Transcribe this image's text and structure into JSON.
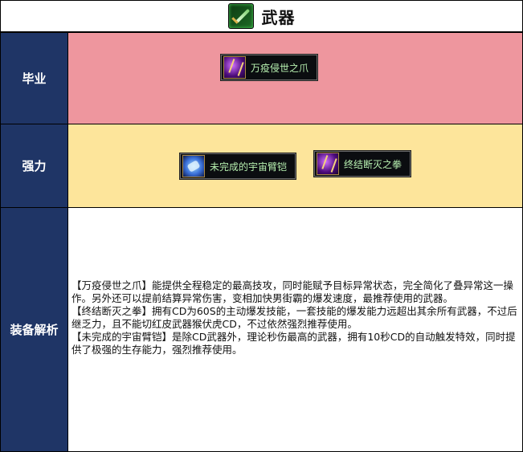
{
  "header": {
    "title": "武器",
    "icon": "sword-icon"
  },
  "rows": {
    "graduation": {
      "label": "毕业",
      "items": [
        {
          "name": "万疫侵世之爪",
          "icon": "claw-icon"
        }
      ]
    },
    "strong": {
      "label": "强力",
      "items": [
        {
          "name": "未完成的宇宙臂铠",
          "icon": "arm-guard-icon"
        },
        {
          "name": "终结断灭之拳",
          "icon": "fist-icon"
        }
      ]
    },
    "analysis": {
      "label": "装备解析",
      "paragraphs": [
        "【万疫侵世之爪】能提供全程稳定的最高技攻，同时能赋予目标异常状态，完全简化了叠异常这一操作。另外还可以提前结算异常伤害，变相加快男街霸的爆发速度，最推荐使用的武器。",
        "【终结断灭之拳】拥有CD为60S的主动爆发技能，一套技能的爆发能力远超出其余所有武器，不过后继乏力，且不能切红皮武器猴伏虎CD，不过依然强烈推荐使用。",
        "【未完成的宇宙臂铠】是除CD武器外，理论秒伤最高的武器，拥有10秒CD的自动触发特效，同时提供了极强的生存能力，强烈推荐使用。"
      ]
    }
  },
  "colors": {
    "label_bg": "#1f3566",
    "graduation_bg": "#ee969e",
    "strong_bg": "#fde59b",
    "item_text": "#b7f0b0"
  }
}
